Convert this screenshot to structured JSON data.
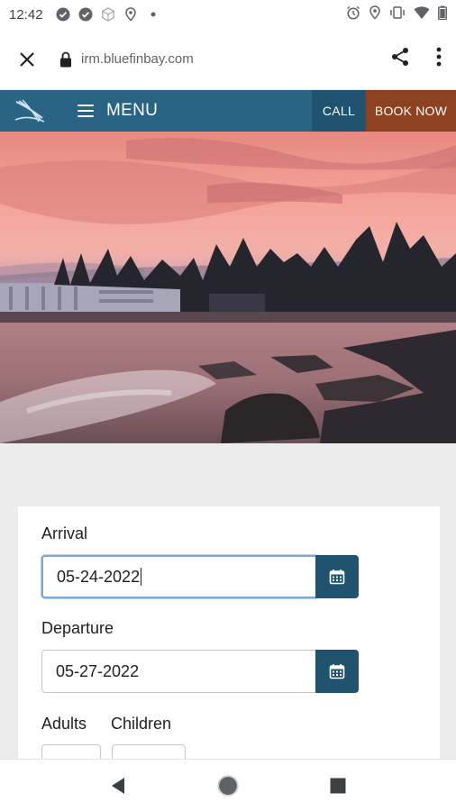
{
  "status_bar": {
    "time": "12:42",
    "left_icons": [
      "check-circle-icon",
      "check-circle-icon",
      "cube-icon",
      "location-icon",
      "dot-icon"
    ],
    "right_icons": [
      "alarm-icon",
      "location-icon",
      "vibrate-icon",
      "wifi-icon",
      "battery-icon"
    ]
  },
  "browser": {
    "url": "irm.bluefinbay.com",
    "close_icon": "close-icon",
    "lock_icon": "lock-icon",
    "share_icon": "share-icon",
    "more_icon": "more-vert-icon"
  },
  "site_header": {
    "logo_icon": "sail-logo-icon",
    "menu_label": "MENU",
    "call_label": "CALL",
    "book_label": "BOOK NOW",
    "colors": {
      "bar": "#2a6484",
      "call": "#1f536f",
      "book": "#8c4121"
    }
  },
  "booking_form": {
    "arrival_label": "Arrival",
    "arrival_value": "05-24-2022",
    "departure_label": "Departure",
    "departure_value": "05-27-2022",
    "adults_label": "Adults",
    "children_label": "Children",
    "calendar_icon": "calendar-icon"
  },
  "nav_bar": {
    "back_icon": "back-triangle-icon",
    "home_icon": "home-circle-icon",
    "recents_icon": "recents-square-icon"
  }
}
